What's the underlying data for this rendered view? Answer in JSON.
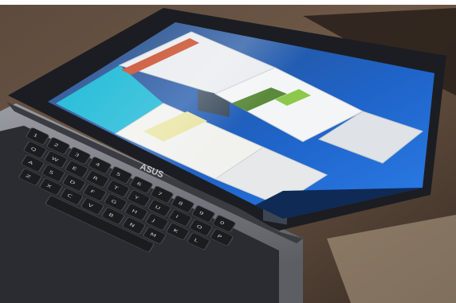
{
  "photo": {
    "subject": "laptop-with-cascaded-windows",
    "colors": {
      "table_wood": "#6b5646",
      "table_dark": "#2b221c",
      "bezel": "#1c1d22",
      "screen_blue": "#1f64c9",
      "desktop_cyan": "#18b8d6",
      "keyboard_deck": "#7a7c82",
      "key_cap": "#1b1c20",
      "key_legend": "#c9c9c9"
    }
  },
  "laptop": {
    "logo_text": "ASUS",
    "keyboard_legends": {
      "row1": [
        "1",
        "2",
        "3",
        "4",
        "5",
        "6",
        "7",
        "8",
        "9",
        "0"
      ],
      "row2": [
        "Q",
        "W",
        "E",
        "R",
        "T",
        "Y",
        "U",
        "I",
        "O",
        "P"
      ],
      "row3": [
        "A",
        "S",
        "D",
        "F",
        "G",
        "H",
        "J",
        "K",
        "L"
      ],
      "row4": [
        "Z",
        "X",
        "C",
        "V",
        "B",
        "N",
        "M"
      ]
    }
  }
}
